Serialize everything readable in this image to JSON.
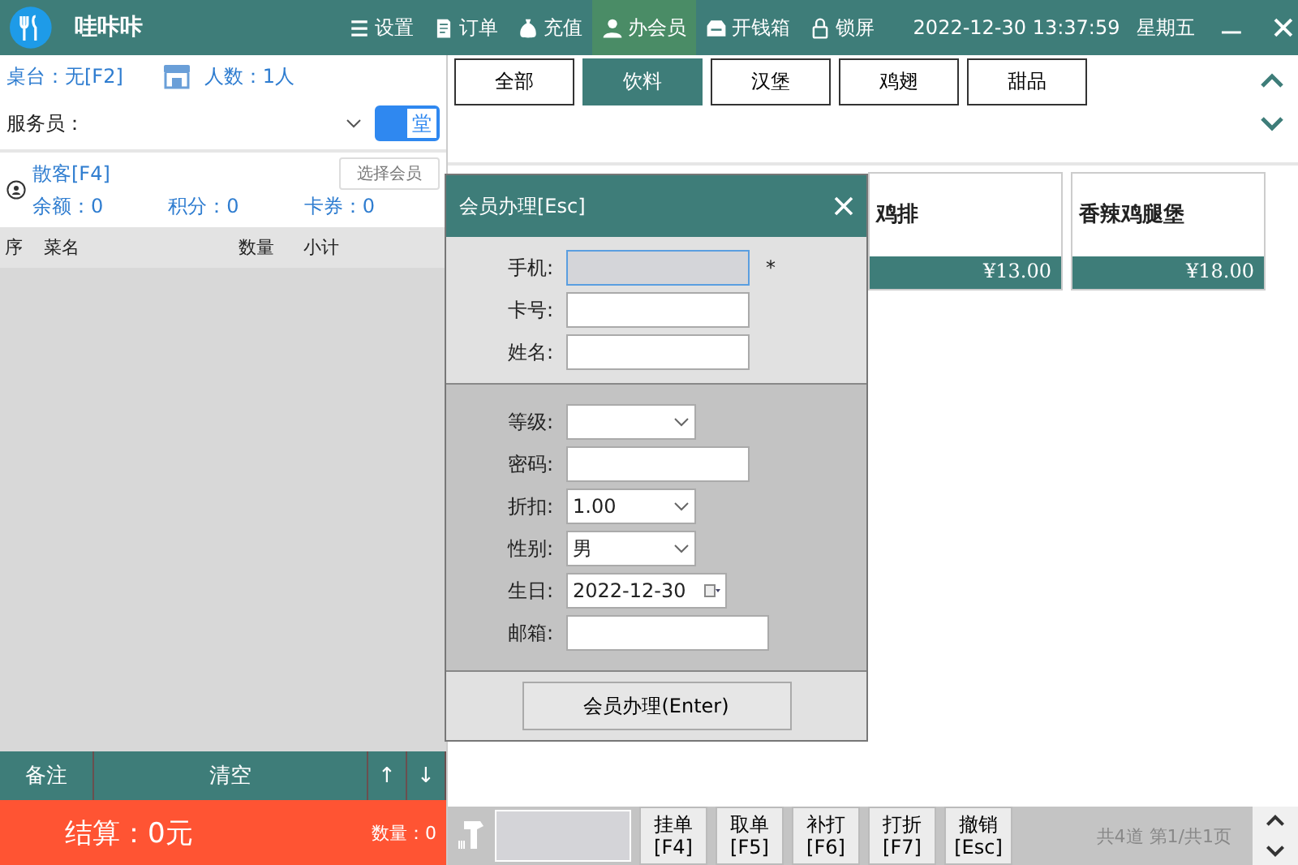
{
  "app": {
    "name": "哇咔咔"
  },
  "menu": [
    {
      "label": "设置",
      "selected": false
    },
    {
      "label": "订单",
      "selected": false
    },
    {
      "label": "充值",
      "selected": false
    },
    {
      "label": "办会员",
      "selected": true
    },
    {
      "label": "开钱箱",
      "selected": false
    },
    {
      "label": "锁屏",
      "selected": false
    }
  ],
  "datetime": "2022-12-30 13:37:59",
  "weekday": "星期五",
  "order_panel": {
    "table": "桌台：无[F2]",
    "guests": "人数：1人",
    "waiter_label": "服务员：",
    "dine_toggle": {
      "label": "堂",
      "on": true
    },
    "member": {
      "name": "散客[F4]",
      "select_button": "选择会员",
      "balance": "余额：0",
      "points": "积分：0",
      "coupons": "卡券：0"
    },
    "columns": [
      "序",
      "菜名",
      "数量",
      "小计"
    ],
    "actions": [
      "备注",
      "清空",
      "↑",
      "↓"
    ],
    "checkout": "结算：0元",
    "quantity": "数量：0"
  },
  "categories": [
    {
      "label": "全部",
      "selected": false
    },
    {
      "label": "饮料",
      "selected": true
    },
    {
      "label": "汉堡",
      "selected": false
    },
    {
      "label": "鸡翅",
      "selected": false
    },
    {
      "label": "甜品",
      "selected": false
    }
  ],
  "products": [
    {
      "name": "鸡排",
      "price": "¥13.00"
    },
    {
      "name": "香辣鸡腿堡",
      "price": "¥18.00"
    }
  ],
  "dialog": {
    "title": "会员办理[Esc]",
    "sections": [
      [
        {
          "label": "手机:",
          "kind": "text",
          "focused": true,
          "required": "*"
        },
        {
          "label": "卡号:",
          "kind": "text",
          "focused": false
        },
        {
          "label": "姓名:",
          "kind": "text",
          "focused": false
        }
      ],
      [
        {
          "label": "等级:",
          "kind": "select",
          "focused": false
        },
        {
          "label": "密码:",
          "kind": "text",
          "focused": false
        },
        {
          "label": "折扣:",
          "kind": "select",
          "value": "1.00",
          "focused": false
        },
        {
          "label": "性别:",
          "kind": "select",
          "value": "男",
          "focused": false
        },
        {
          "label": "生日:",
          "kind": "date",
          "value": "2022-12-30",
          "focused": false
        },
        {
          "label": "邮箱:",
          "kind": "email",
          "focused": false
        }
      ]
    ],
    "submit": "会员办理(Enter)"
  },
  "toolbar": {
    "buttons": [
      {
        "label": "挂单",
        "key": "[F4]"
      },
      {
        "label": "取单",
        "key": "[F5]"
      },
      {
        "label": "补打",
        "key": "[F6]"
      },
      {
        "label": "打折",
        "key": "[F7]"
      },
      {
        "label": "撤销",
        "key": "[Esc]"
      }
    ],
    "page_info": "共4道 第1/共1页"
  }
}
